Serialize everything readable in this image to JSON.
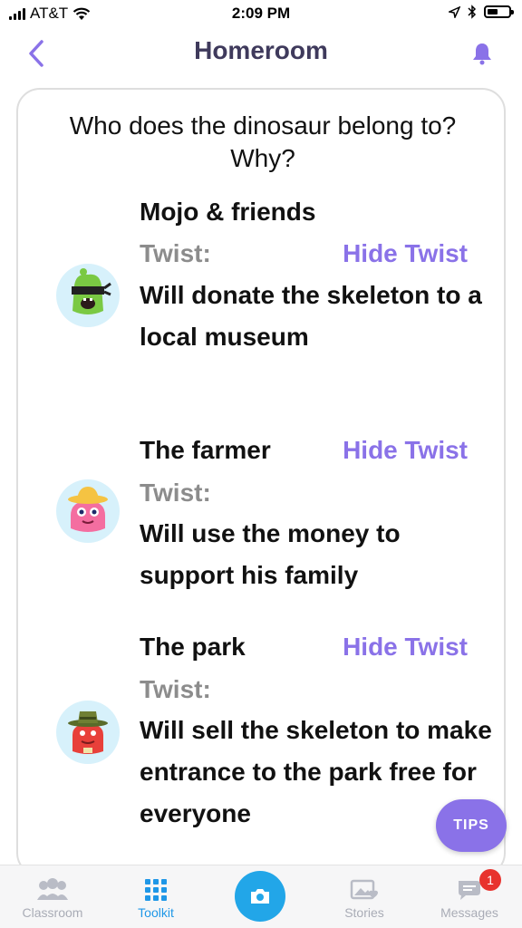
{
  "status": {
    "carrier": "AT&T",
    "time": "2:09 PM",
    "battery_level": 0.5
  },
  "nav": {
    "title": "Homeroom"
  },
  "card": {
    "question": "Who does the dinosaur belong to? Why?",
    "items": [
      {
        "name": "Mojo & friends",
        "hide_label": "Hide Twist",
        "twist_label": "Twist:",
        "twist_text": "Will donate the skeleton to a local museum",
        "avatar_icon": "mojo-monster-icon"
      },
      {
        "name": "The farmer",
        "hide_label": "Hide Twist",
        "twist_label": "Twist:",
        "twist_text": "Will use the money to support his family",
        "avatar_icon": "farmer-monster-icon"
      },
      {
        "name": "The park",
        "hide_label": "Hide Twist",
        "twist_label": "Twist:",
        "twist_text": "Will sell the skeleton to make entrance to the park free for everyone",
        "avatar_icon": "ranger-monster-icon"
      }
    ]
  },
  "tips_label": "TIPS",
  "tabbar": {
    "tabs": [
      {
        "label": "Classroom",
        "icon": "classroom-icon",
        "active": false
      },
      {
        "label": "Toolkit",
        "icon": "toolkit-grid-icon",
        "active": true
      },
      {
        "label": "",
        "icon": "camera-icon",
        "active": false
      },
      {
        "label": "Stories",
        "icon": "stories-icon",
        "active": false
      },
      {
        "label": "Messages",
        "icon": "messages-icon",
        "active": false
      }
    ],
    "messages_badge": "1"
  },
  "colors": {
    "accent_purple": "#8a72e8",
    "title_navy": "#3f3a5c",
    "tab_active_blue": "#1f97e7",
    "camera_blue": "#22a6e8",
    "badge_red": "#e8322d"
  }
}
